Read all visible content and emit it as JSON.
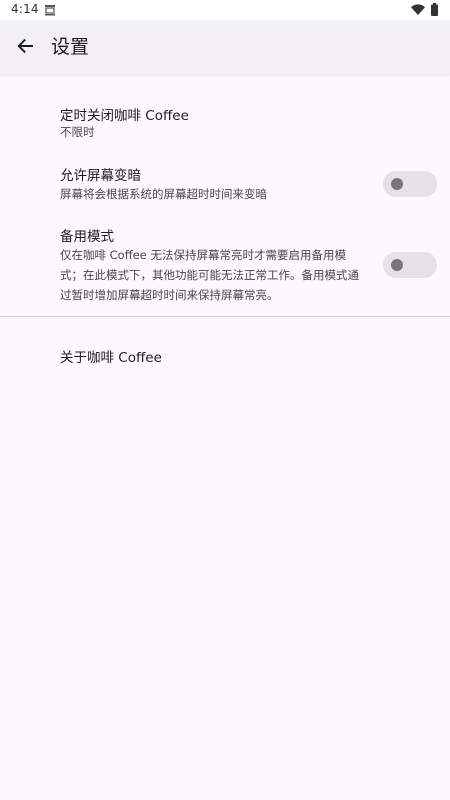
{
  "status_bar": {
    "time": "4:14"
  },
  "app_bar": {
    "title": "设置",
    "back_icon": "arrow-back-icon"
  },
  "settings": {
    "timer": {
      "title": "定时关闭咖啡 Coffee",
      "summary": "不限时"
    },
    "allow_dim": {
      "title": "允许屏幕变暗",
      "summary": "屏幕将会根据系统的屏幕超时时间来变暗",
      "enabled": false
    },
    "backup_mode": {
      "title": "备用模式",
      "summary": "仅在咖啡 Coffee 无法保持屏幕常亮时才需要启用备用模式；在此模式下，其他功能可能无法正常工作。备用模式通过暂时增加屏幕超时时间来保持屏幕常亮。",
      "enabled": false
    },
    "about": {
      "title": "关于咖啡 Coffee"
    }
  },
  "colors": {
    "background": "#fdf7fe",
    "app_bar": "#f3eff6",
    "switch_track_off": "#e5e1e9",
    "switch_thumb_off": "#79747e",
    "divider": "#d9d5dc"
  }
}
